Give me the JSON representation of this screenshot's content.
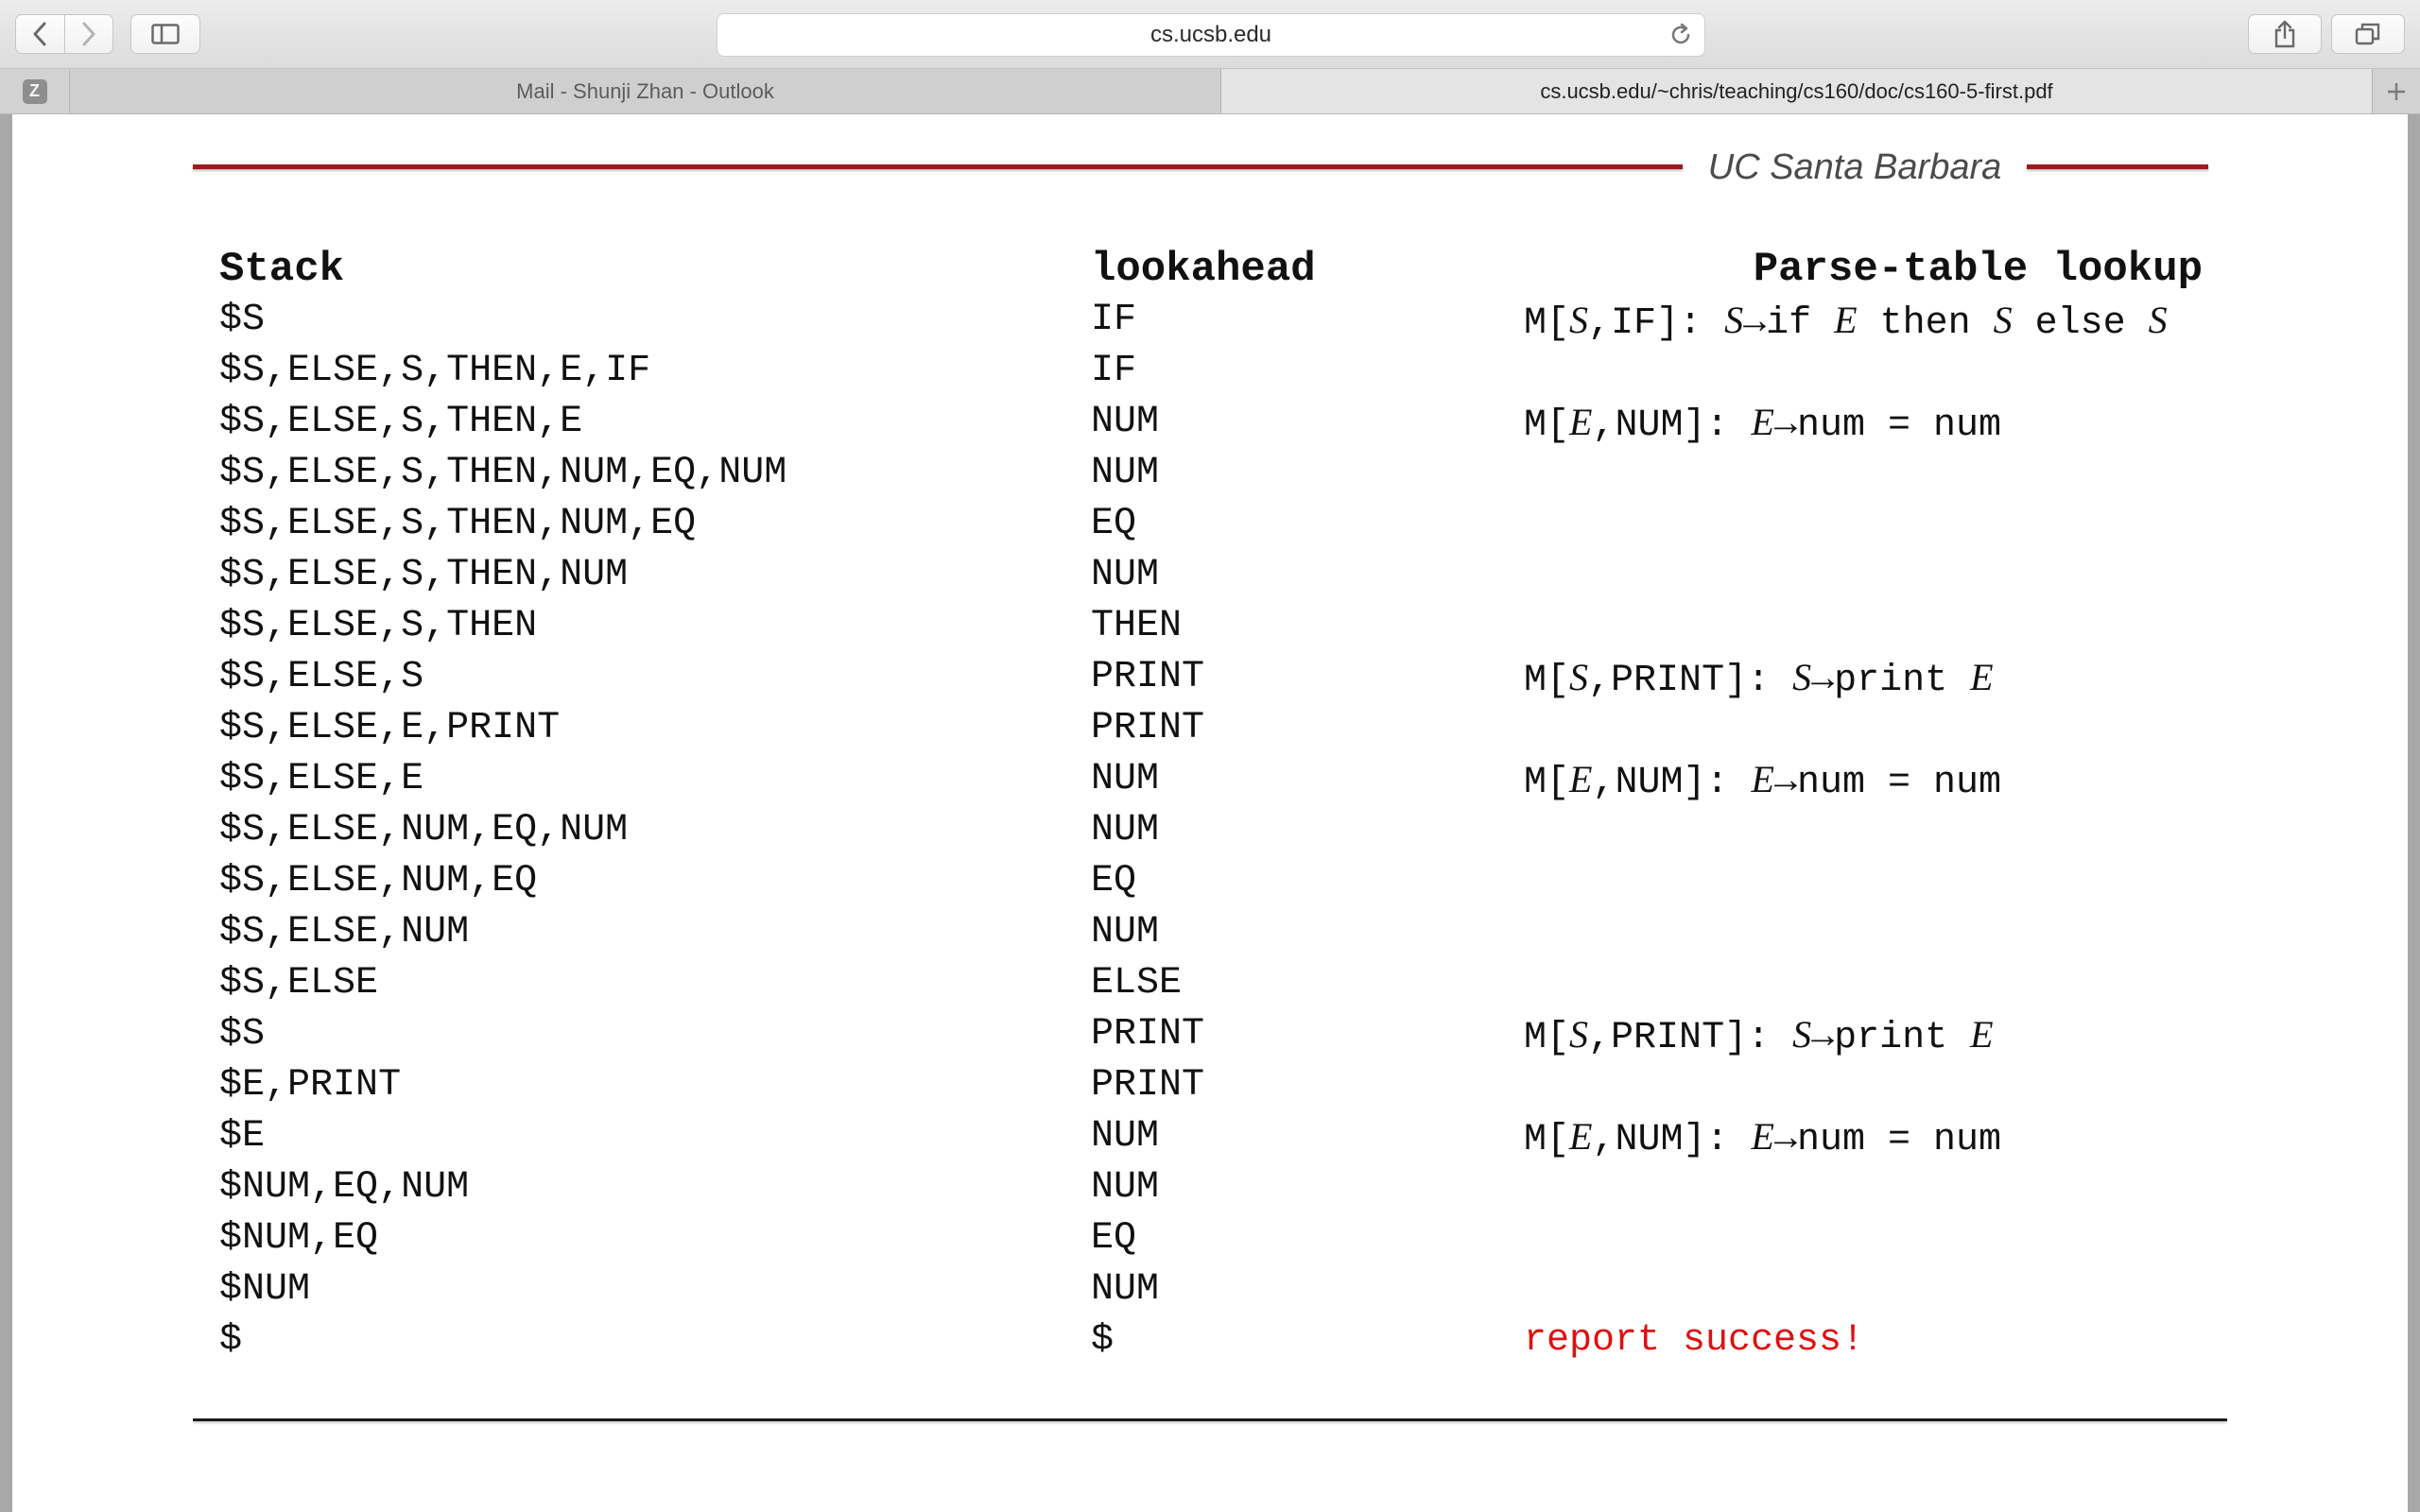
{
  "browser": {
    "address": "cs.ucsb.edu",
    "tabs": [
      {
        "label": "Mail - Shunji Zhan - Outlook"
      },
      {
        "label": "cs.ucsb.edu/~chris/teaching/cs160/doc/cs160-5-first.pdf"
      }
    ],
    "pinned_tab_letter": "Z"
  },
  "slide": {
    "header_title": "UC Santa Barbara",
    "columns": {
      "stack": "Stack",
      "lookahead": "lookahead",
      "lookup": "Parse-table lookup"
    },
    "rows": [
      {
        "stack": "$S",
        "lookahead": "IF",
        "lookup": "M[S,IF]: S→if E then S else S"
      },
      {
        "stack": "$S,ELSE,S,THEN,E,IF",
        "lookahead": "IF",
        "lookup": ""
      },
      {
        "stack": "$S,ELSE,S,THEN,E",
        "lookahead": "NUM",
        "lookup": "M[E,NUM]: E→num = num"
      },
      {
        "stack": "$S,ELSE,S,THEN,NUM,EQ,NUM",
        "lookahead": "NUM",
        "lookup": ""
      },
      {
        "stack": "$S,ELSE,S,THEN,NUM,EQ",
        "lookahead": "EQ",
        "lookup": ""
      },
      {
        "stack": "$S,ELSE,S,THEN,NUM",
        "lookahead": "NUM",
        "lookup": ""
      },
      {
        "stack": "$S,ELSE,S,THEN",
        "lookahead": "THEN",
        "lookup": ""
      },
      {
        "stack": "$S,ELSE,S",
        "lookahead": "PRINT",
        "lookup": "M[S,PRINT]: S→print E"
      },
      {
        "stack": "$S,ELSE,E,PRINT",
        "lookahead": "PRINT",
        "lookup": ""
      },
      {
        "stack": "$S,ELSE,E",
        "lookahead": "NUM",
        "lookup": "M[E,NUM]: E→num = num"
      },
      {
        "stack": "$S,ELSE,NUM,EQ,NUM",
        "lookahead": "NUM",
        "lookup": ""
      },
      {
        "stack": "$S,ELSE,NUM,EQ",
        "lookahead": "EQ",
        "lookup": ""
      },
      {
        "stack": "$S,ELSE,NUM",
        "lookahead": "NUM",
        "lookup": ""
      },
      {
        "stack": "$S,ELSE",
        "lookahead": "ELSE",
        "lookup": ""
      },
      {
        "stack": "$S",
        "lookahead": "PRINT",
        "lookup": "M[S,PRINT]: S→print E"
      },
      {
        "stack": "$E,PRINT",
        "lookahead": "PRINT",
        "lookup": ""
      },
      {
        "stack": "$E",
        "lookahead": "NUM",
        "lookup": "M[E,NUM]: E→num = num"
      },
      {
        "stack": "$NUM,EQ,NUM",
        "lookahead": "NUM",
        "lookup": ""
      },
      {
        "stack": "$NUM,EQ",
        "lookahead": "EQ",
        "lookup": ""
      },
      {
        "stack": "$NUM",
        "lookahead": "NUM",
        "lookup": ""
      },
      {
        "stack": "$",
        "lookahead": "$",
        "lookup": "report success!",
        "lookup_style": "success"
      }
    ]
  },
  "colors": {
    "accent_rule": "#9b1b1e",
    "success_text": "#e01010"
  }
}
